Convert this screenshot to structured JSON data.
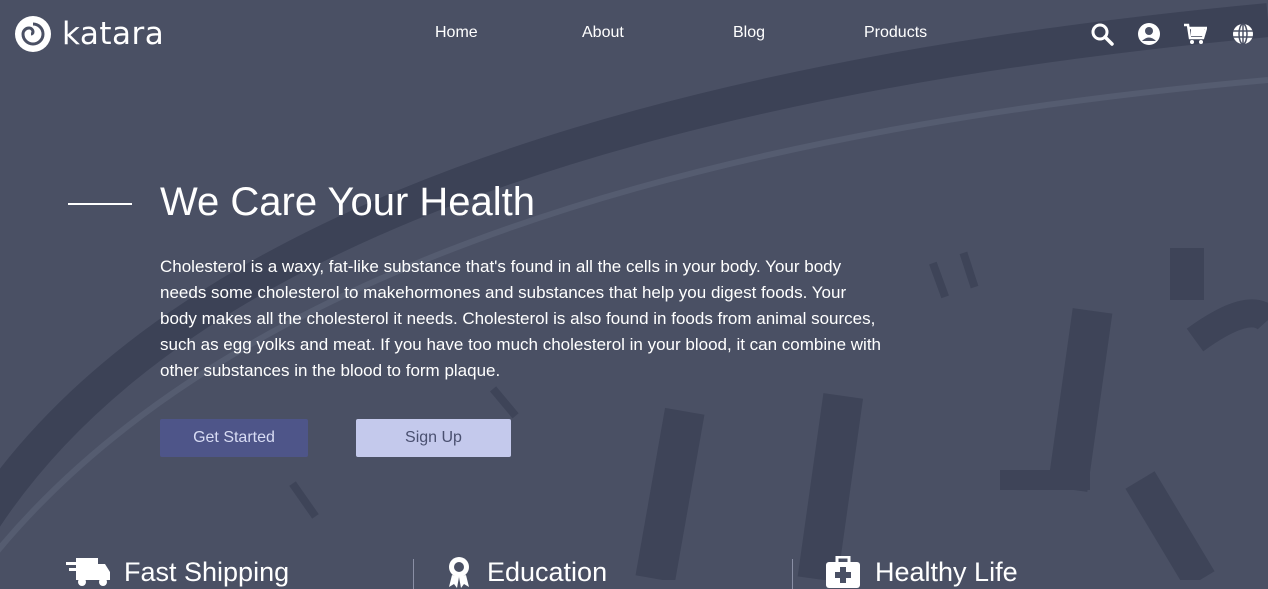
{
  "brand": {
    "name": "katara"
  },
  "nav": {
    "items": [
      "Home",
      "About",
      "Blog",
      "Products"
    ]
  },
  "toolbar": {
    "icons": [
      "search-icon",
      "user-icon",
      "cart-icon",
      "globe-icon"
    ]
  },
  "hero": {
    "title": "We Care Your Health",
    "body": "Cholesterol is a waxy, fat-like substance that's found in all the cells in your body. Your body needs some cholesterol to makehormones and substances that help you digest foods. Your body makes all the cholesterol it needs. Cholesterol is also found in foods from animal sources, such as egg yolks and meat. If you have too much cholesterol in your blood, it can combine with other substances in the blood to form plaque.",
    "primary_cta": "Get Started",
    "secondary_cta": "Sign Up"
  },
  "features": [
    {
      "label": "Fast Shipping",
      "icon": "truck-icon"
    },
    {
      "label": "Education",
      "icon": "award-icon"
    },
    {
      "label": "Healthy Life",
      "icon": "medical-kit-icon"
    }
  ],
  "colors": {
    "background": "#4a5064",
    "primary_button": "#4e5589",
    "secondary_button": "#c4c9ec"
  }
}
